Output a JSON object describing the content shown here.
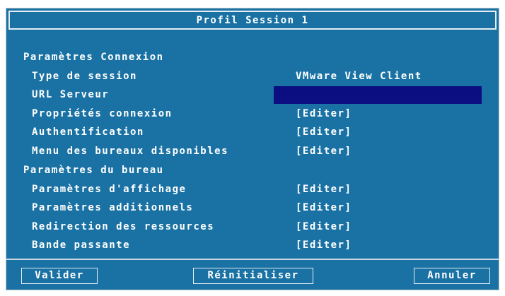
{
  "title": "Profil Session 1",
  "sections": {
    "connexion": "Paramètres Connexion",
    "bureau": "Paramètres du bureau"
  },
  "rows": {
    "type_session": {
      "label": "Type de session",
      "value": "VMware View Client"
    },
    "url_serveur": {
      "label": "URL Serveur",
      "value": ""
    },
    "proprietes": {
      "label": "Propriétés connexion",
      "value": "[Editer]"
    },
    "authentification": {
      "label": "Authentification",
      "value": "[Editer]"
    },
    "menu_bureaux": {
      "label": "Menu des bureaux disponibles",
      "value": "[Editer]"
    },
    "affichage": {
      "label": "Paramètres d'affichage",
      "value": "[Editer]"
    },
    "additionnels": {
      "label": "Paramètres additionnels",
      "value": "[Editer]"
    },
    "redirection": {
      "label": "Redirection des ressources",
      "value": "[Editer]"
    },
    "bande": {
      "label": "Bande passante",
      "value": "[Editer]"
    }
  },
  "buttons": {
    "valider": "Valider",
    "reinitialiser": "Réinitialiser",
    "annuler": "Annuler"
  }
}
